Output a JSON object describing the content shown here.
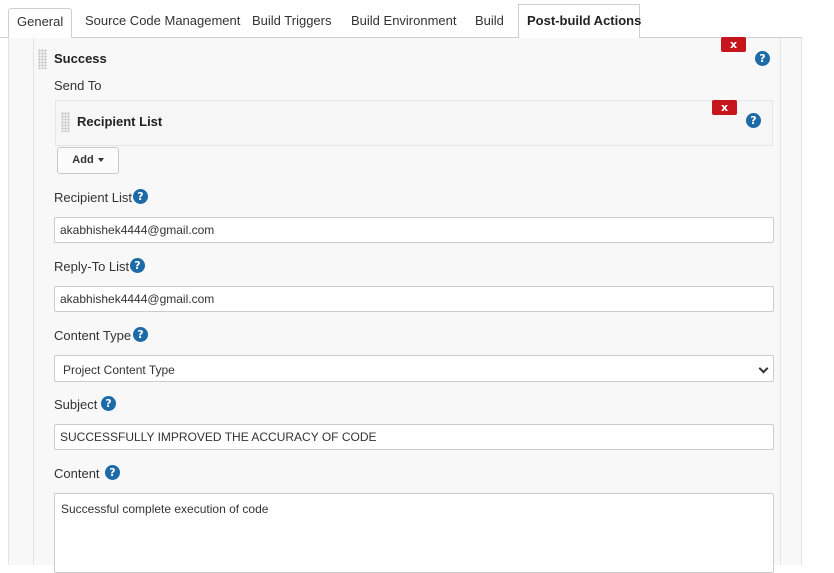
{
  "tabs": [
    {
      "label": "General"
    },
    {
      "label": "Source Code Management"
    },
    {
      "label": "Build Triggers"
    },
    {
      "label": "Build Environment"
    },
    {
      "label": "Build"
    },
    {
      "label": "Post-build Actions"
    }
  ],
  "active_tab": "Post-build Actions",
  "trigger": {
    "title": "Success",
    "send_to_label": "Send To",
    "recipient_item": "Recipient List",
    "add_button": "Add",
    "delete_label": "x",
    "help_label": "?"
  },
  "fields": {
    "recipient_list": {
      "label": "Recipient List",
      "value": "akabhishek4444@gmail.com"
    },
    "reply_to_list": {
      "label": "Reply-To List",
      "value": "akabhishek4444@gmail.com"
    },
    "content_type": {
      "label": "Content Type",
      "selected": "Project Content Type"
    },
    "subject": {
      "label": "Subject",
      "value": "SUCCESSFULLY IMPROVED THE ACCURACY OF CODE"
    },
    "content": {
      "label": "Content",
      "value": "Successful  complete execution of code"
    }
  },
  "colors": {
    "help": "#1c6aa8",
    "delete": "#c4161c",
    "panel_bg": "#f8f8f8"
  }
}
